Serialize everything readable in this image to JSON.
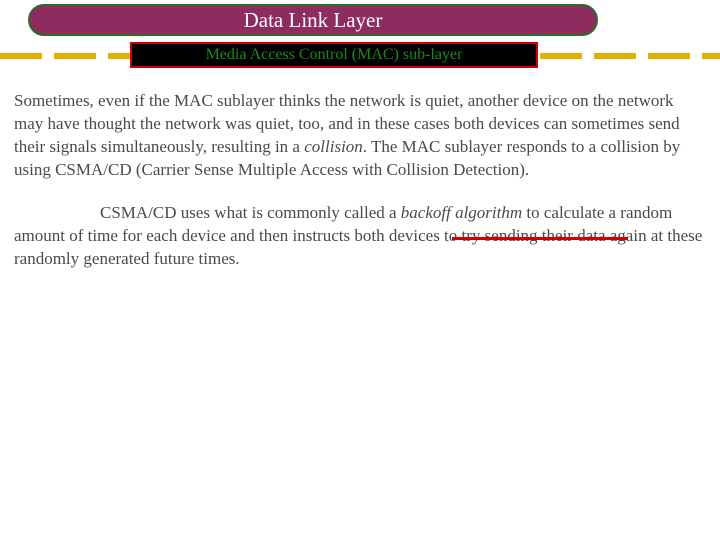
{
  "title": "Data Link Layer",
  "subtitle": "Media Access Control (MAC) sub-layer",
  "paragraphs": {
    "p1_a": "Sometimes, even if the MAC sublayer thinks the network is quiet, another device on the network may have thought the network was quiet, too, and in these cases both devices can sometimes send their signals simultaneously, resulting in a ",
    "p1_collision": "collision",
    "p1_b": ". The MAC sublayer responds to a collision by using CSMA/CD (Carrier Sense Multiple Access with Collision Detection).",
    "p2_a": "CSMA/CD uses what is commonly called a ",
    "p2_backoff": "backoff algorithm",
    "p2_b": " to calculate a random amount of time for each device and then instructs both devices to try sending their data again at these randomly generated future times."
  },
  "colors": {
    "title_bg": "#8e2b5f",
    "title_border": "#2b6b2b",
    "dash": "#e0b000",
    "subtitle_bg": "#000000",
    "subtitle_border": "#d00000",
    "subtitle_text": "#1a8a1a",
    "underline": "#d00000"
  }
}
